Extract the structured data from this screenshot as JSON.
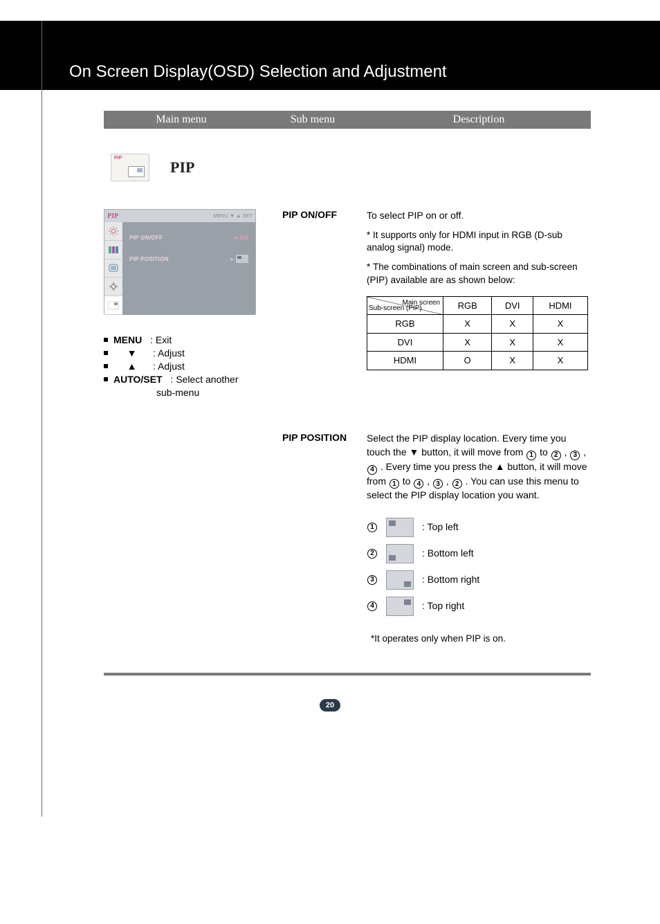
{
  "header": {
    "title": "On Screen Display(OSD) Selection and Adjustment"
  },
  "submenu_bar": {
    "main": "Main menu",
    "sub": "Sub menu",
    "desc": "Description"
  },
  "pip": {
    "icon_label": "PIP",
    "heading": "PIP"
  },
  "osd": {
    "brand": "PIP",
    "menu_btn": "MENU",
    "set_btn": "SET",
    "item1": "PIP ON/OFF",
    "item1_val": "ON",
    "item2": "PIP POSITION"
  },
  "controls": {
    "menu_label": "MENU",
    "menu_desc": ": Exit",
    "down_desc": ": Adjust",
    "up_desc": ": Adjust",
    "autoset_label": "AUTO/SET",
    "autoset_desc": ": Select another",
    "autoset_desc2": "sub-menu"
  },
  "onoff": {
    "label": "PIP ON/OFF",
    "desc": "To select PIP on or off.",
    "note1": "It supports only for HDMI input in RGB (D-sub analog signal) mode.",
    "note2": "The combinations of main screen and sub-screen (PIP) available are as shown below:"
  },
  "table": {
    "diag_main": "Main screen",
    "diag_sub": "Sub-screen (PIP)",
    "cols": [
      "RGB",
      "DVI",
      "HDMI"
    ],
    "rows": [
      {
        "label": "RGB",
        "cells": [
          "X",
          "X",
          "X"
        ]
      },
      {
        "label": "DVI",
        "cells": [
          "X",
          "X",
          "X"
        ]
      },
      {
        "label": "HDMI",
        "cells": [
          "O",
          "X",
          "X"
        ]
      }
    ]
  },
  "position": {
    "label": "PIP POSITION",
    "desc_a": "Select the PIP display location. Every time you touch the ",
    "desc_b": " button, it will move from ",
    "desc_c": " to ",
    "desc_d": " , ",
    "desc_e": " , ",
    "desc_f": " . Every time you press the ",
    "desc_g": " button, it will move from ",
    "desc_h": " to ",
    "desc_i": " , ",
    "desc_j": " , ",
    "desc_k": " . You can use this menu to select the PIP display location you want.",
    "items": [
      {
        "num": "1",
        "label": ": Top left"
      },
      {
        "num": "2",
        "label": ": Bottom left"
      },
      {
        "num": "3",
        "label": ": Bottom right"
      },
      {
        "num": "4",
        "label": ": Top right"
      }
    ],
    "footnote": "*It operates only when PIP is on."
  },
  "page_number": "20"
}
